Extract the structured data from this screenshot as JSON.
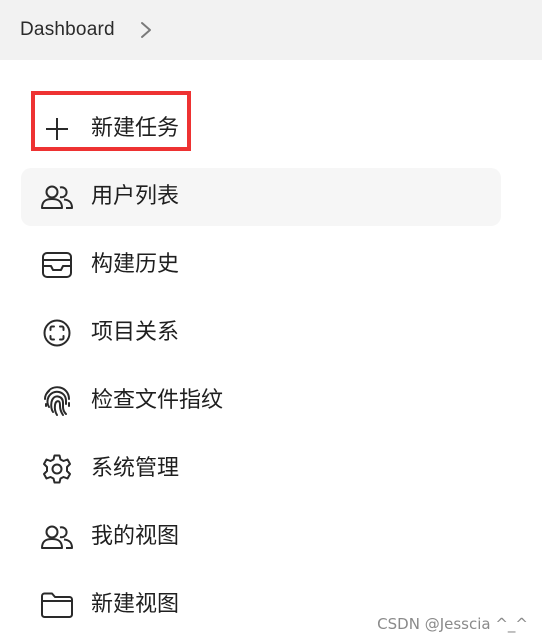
{
  "header": {
    "breadcrumb": "Dashboard",
    "chevron_icon": "chevron-right-icon"
  },
  "menu": {
    "items": [
      {
        "label": "新建任务",
        "icon": "plus-icon"
      },
      {
        "label": "用户列表",
        "icon": "users-icon"
      },
      {
        "label": "构建历史",
        "icon": "inbox-icon"
      },
      {
        "label": "项目关系",
        "icon": "focus-circle-icon"
      },
      {
        "label": "检查文件指纹",
        "icon": "fingerprint-icon"
      },
      {
        "label": "系统管理",
        "icon": "gear-icon"
      },
      {
        "label": "我的视图",
        "icon": "users-icon"
      },
      {
        "label": "新建视图",
        "icon": "folder-icon"
      }
    ]
  },
  "colors": {
    "highlight_border": "#ee3232",
    "header_bg": "#f2f2f2",
    "hover_bg": "#f6f6f6"
  },
  "watermark": "CSDN @Jesscia ^_^"
}
